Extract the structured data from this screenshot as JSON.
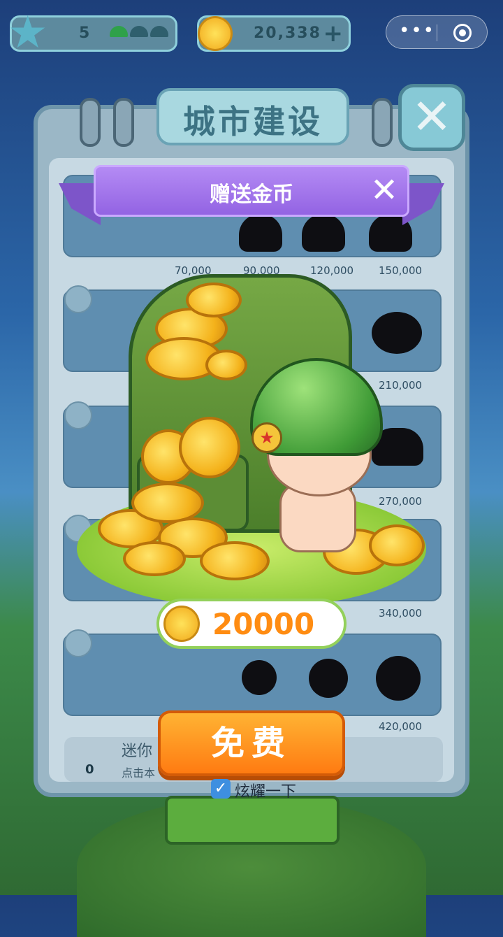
{
  "top_bar": {
    "level": "5",
    "coins": "20,338",
    "plus_label": "+",
    "helmets_total": 3,
    "helmets_filled": 1
  },
  "mini_program": {
    "more_label": "•••"
  },
  "panel": {
    "title": "城市建设",
    "close_label": "✕",
    "rows": [
      {
        "prices": [
          "70,000",
          "90,000",
          "120,000",
          "150,000"
        ]
      },
      {
        "prices": [
          "210,000"
        ]
      },
      {
        "prices": [
          "270,000"
        ]
      },
      {
        "prices": [
          "340,000"
        ]
      },
      {
        "prices": [
          "420,000"
        ]
      }
    ],
    "bottom": {
      "title": "迷你",
      "subtitle": "点击本",
      "count": "0"
    }
  },
  "modal": {
    "title": "赠送金币",
    "close_label": "✕",
    "reward_amount": "20000",
    "free_button_label": "免费",
    "share_label": "炫耀一下",
    "share_checked": true
  },
  "colors": {
    "accent_purple": "#9b6be6",
    "button_orange": "#ff8c12",
    "reward_text": "#ff8c12"
  }
}
